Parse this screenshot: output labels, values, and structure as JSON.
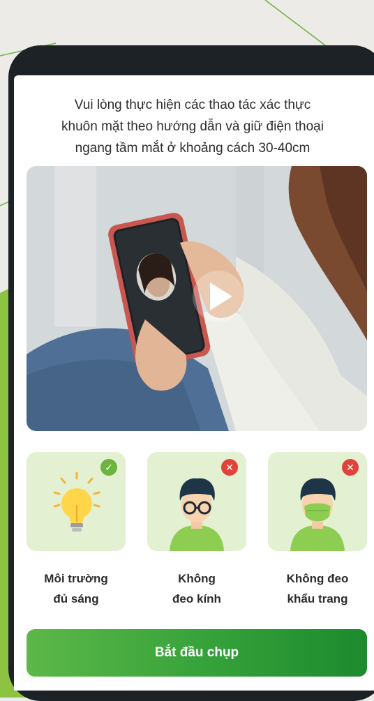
{
  "instruction": {
    "line1": "Vui lòng thực hiện các thao tác xác thực",
    "line2": "khuôn mặt theo hướng dẫn và giữ điện thoại",
    "line3": "ngang tầm mắt ở khoảng cách 30-40cm"
  },
  "video": {
    "play_icon": "play-icon"
  },
  "requirements": [
    {
      "line1": "Môi trường",
      "line2": "đủ sáng",
      "status": "ok",
      "icon": "lightbulb-icon"
    },
    {
      "line1": "Không",
      "line2": "đeo kính",
      "status": "not-allowed",
      "icon": "person-glasses-icon"
    },
    {
      "line1": "Không đeo",
      "line2": "khẩu trang",
      "status": "not-allowed",
      "icon": "person-mask-icon"
    }
  ],
  "status_symbols": {
    "ok": "✓",
    "no": "✕"
  },
  "start_button": {
    "label": "Bắt đầu chụp"
  },
  "colors": {
    "accent_green": "#35a13a",
    "card_bg": "#e3f0d2",
    "ok": "#6cb340",
    "error": "#e0433c"
  }
}
